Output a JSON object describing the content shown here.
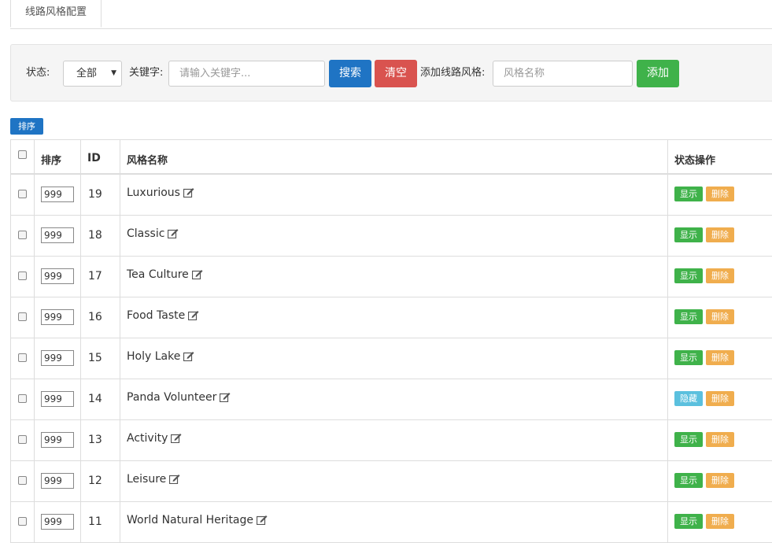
{
  "tabs": [
    "线路风格配置"
  ],
  "filter": {
    "status_label": "状态:",
    "status_value": "全部",
    "keyword_label": "关键字:",
    "keyword_placeholder": "请输入关键字...",
    "search_label": "搜索",
    "clear_label": "清空",
    "add_style_label": "添加线路风格:",
    "style_name_placeholder": "风格名称",
    "add_label": "添加"
  },
  "sort_button": "排序",
  "table": {
    "headers": {
      "order": "排序",
      "id": "ID",
      "name": "风格名称",
      "actions": "状态操作"
    },
    "rows": [
      {
        "order": "999",
        "id": "19",
        "name": "Luxurious",
        "status": "显示",
        "status_type": "show",
        "delete": "删除"
      },
      {
        "order": "999",
        "id": "18",
        "name": "Classic",
        "status": "显示",
        "status_type": "show",
        "delete": "删除"
      },
      {
        "order": "999",
        "id": "17",
        "name": "Tea Culture",
        "status": "显示",
        "status_type": "show",
        "delete": "删除"
      },
      {
        "order": "999",
        "id": "16",
        "name": "Food Taste",
        "status": "显示",
        "status_type": "show",
        "delete": "删除"
      },
      {
        "order": "999",
        "id": "15",
        "name": "Holy Lake",
        "status": "显示",
        "status_type": "show",
        "delete": "删除"
      },
      {
        "order": "999",
        "id": "14",
        "name": "Panda Volunteer",
        "status": "隐藏",
        "status_type": "hide",
        "delete": "删除"
      },
      {
        "order": "999",
        "id": "13",
        "name": "Activity",
        "status": "显示",
        "status_type": "show",
        "delete": "删除"
      },
      {
        "order": "999",
        "id": "12",
        "name": "Leisure",
        "status": "显示",
        "status_type": "show",
        "delete": "删除"
      },
      {
        "order": "999",
        "id": "11",
        "name": "World Natural Heritage",
        "status": "显示",
        "status_type": "show",
        "delete": "删除"
      }
    ]
  },
  "colors": {
    "primary": "#1f74c4",
    "danger": "#d9534f",
    "success": "#3fb24a",
    "info": "#5bc0de",
    "warning": "#f0ad4e"
  }
}
